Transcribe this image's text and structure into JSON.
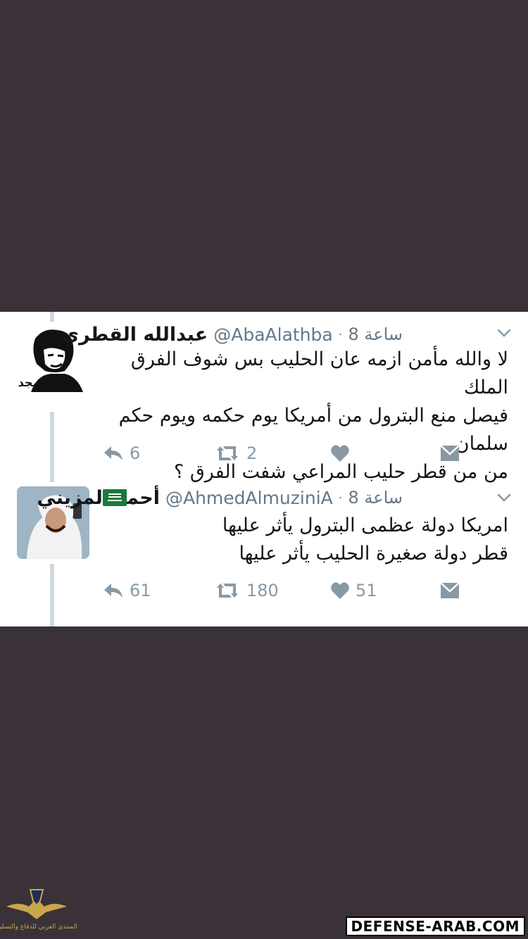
{
  "tweets": [
    {
      "name": "عبدالله القطري",
      "handle": "@AbaAlathba",
      "time": "8 ساعة",
      "text": "لا والله مأمن ازمه عان الحليب  بس شوف الفرق الملك\nفيصل منع البترول من أمريكا يوم حكمه ويوم حكم سلمان\nمن من قطر حليب المراعي شفت الفرق ؟",
      "avatar_caption": "تميم المجد",
      "replies": "6",
      "retweets": "2",
      "likes": ""
    },
    {
      "name": "أحمد المزيني",
      "handle": "@AhmedAlmuziniA",
      "time": "8 ساعة",
      "text": "امريكا دولة عظمى البترول يأثر عليها\nقطر دولة صغيرة الحليب يأثر عليها",
      "replies": "61",
      "retweets": "180",
      "likes": "51"
    }
  ],
  "watermark": {
    "site": "DEFENSE-ARAB.COM",
    "forum_name": "المنتدى العربي للدفاع والتسليح"
  },
  "colors": {
    "background": "#3a3238",
    "card": "#ffffff",
    "text": "#14171a",
    "muted": "#8899a6",
    "thread_line": "#cfd9de"
  },
  "icons": [
    "reply-icon",
    "retweet-icon",
    "like-icon",
    "message-icon",
    "chevron-down-icon",
    "saudi-flag-icon"
  ]
}
